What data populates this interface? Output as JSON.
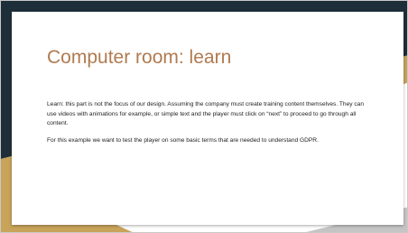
{
  "slide": {
    "title": "Computer room: learn",
    "paragraphs": [
      "Learn: this part is not the focus of our design. Assuming the company must create training content themselves. They can use videos with animations for example, or simple text and the player must click on “next” to proceed to go through all content.",
      "For this example we want to test the player on some basic terms that are needed to understand GDPR."
    ]
  },
  "colors": {
    "title": "#B07A4F",
    "dark_band": "#1F2F3A",
    "gold_band": "#C8A35A",
    "grey_band": "#C4C4C4",
    "background": "#FFFFFF"
  }
}
